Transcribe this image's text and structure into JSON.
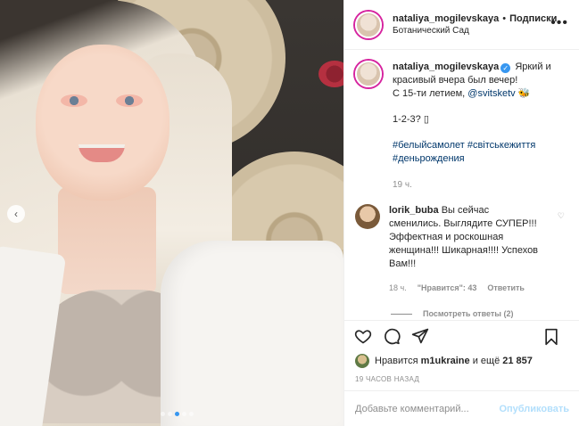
{
  "post": {
    "username": "nataliya_mogilevskaya",
    "follow_label": "Подписки",
    "location": "Ботанический Сад",
    "more_label": "•••",
    "caption": {
      "username": "nataliya_mogilevskaya",
      "line1": "Яркий и красивый вчера был вечер!",
      "line2_prefix": "С 15-ти летием, ",
      "mention": "@svitsketv",
      "line2_suffix": " 🐝",
      "line3": "1-2-3? ▯",
      "hashtags_line1": "#белыйсамолет #світськежиття",
      "hashtags_line2": "#деньрождения",
      "time": "19 ч."
    },
    "comment": {
      "username": "lorik_buba",
      "text": "Вы сейчас сменились. Выглядите СУПЕР!!! Эффектная и роскошная женщина!!! Шикарная!!!! Успехов Вам!!!",
      "time": "18 ч.",
      "likes": "\"Нравится\": 43",
      "reply": "Ответить",
      "view_replies": "Посмотреть ответы (2)"
    },
    "likes_text_prefix": "Нравится ",
    "likes_user": "m1ukraine",
    "likes_text_suffix": " и ещё ",
    "likes_count": "21 857",
    "ago": "19 ЧАСОВ НАЗАД",
    "add_comment_placeholder": "Добавьте комментарий...",
    "publish_label": "Опубликовать",
    "nav_prev": "‹",
    "carousel": {
      "count": 5,
      "active_index": 2
    }
  },
  "colors": {
    "accent": "#3897f0",
    "link": "#00376b",
    "muted": "#8e8e8e",
    "publish_disabled": "#b2dffc"
  },
  "icons": [
    "heart-icon",
    "comment-icon",
    "share-icon",
    "bookmark-icon",
    "verified-icon",
    "more-icon",
    "chevron-left-icon"
  ]
}
